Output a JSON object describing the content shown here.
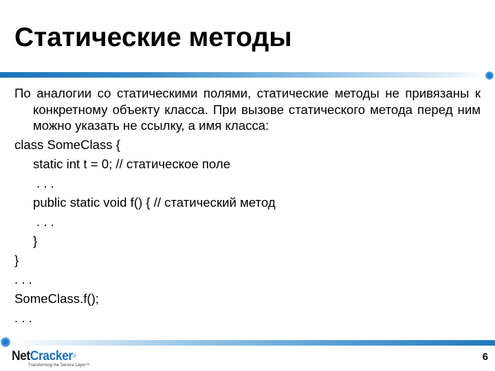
{
  "slide": {
    "title": "Статические методы",
    "paragraph": "По аналогии со статическими полями, статические методы не привязаны к конкретному объекту класса. При вызове статического метода перед ним можно указать не ссылку, а имя класса:",
    "code_lines": [
      "class SomeClass {",
      "static int t = 0; // статическое поле",
      ". . .",
      "public static void f() { // статический метод",
      ". . .",
      "}",
      "}",
      ". . .",
      "SomeClass.f();",
      ". . ."
    ],
    "page_number": "6"
  },
  "footer": {
    "logo_part1": "Net",
    "logo_part2": "Cracker",
    "logo_reg": "®",
    "logo_tagline": "Transforming the Service Layer™"
  },
  "colors": {
    "accent_dark_blue": "#1a74b8",
    "logo_blue": "#1d6fb8"
  }
}
